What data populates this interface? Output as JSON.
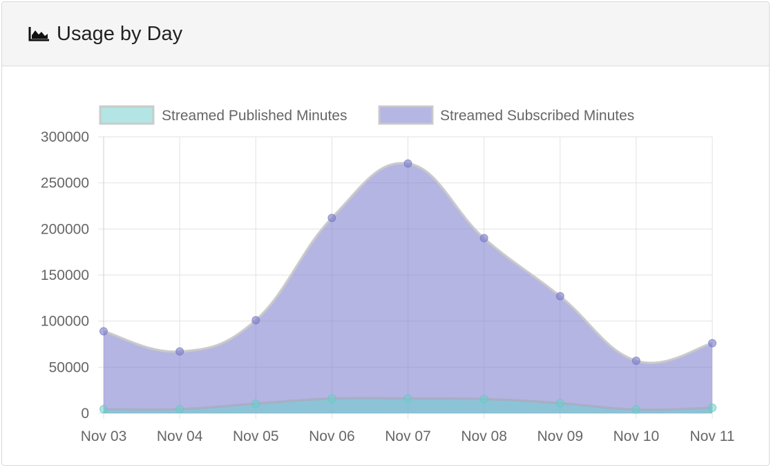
{
  "panel": {
    "title": "Usage by Day",
    "icon": "area-chart-icon"
  },
  "chart_data": {
    "type": "area",
    "categories": [
      "Nov 03",
      "Nov 04",
      "Nov 05",
      "Nov 06",
      "Nov 07",
      "Nov 08",
      "Nov 09",
      "Nov 10",
      "Nov 11"
    ],
    "series": [
      {
        "name": "Streamed Published Minutes",
        "values": [
          4500,
          4500,
          10500,
          16000,
          16000,
          15500,
          11000,
          4000,
          6000
        ],
        "color": "#7fd3d0"
      },
      {
        "name": "Streamed Subscribed Minutes",
        "values": [
          89000,
          67000,
          101000,
          212000,
          271000,
          190000,
          127000,
          57000,
          76000
        ],
        "color": "#8e8fd4"
      }
    ],
    "yticks": [
      "300000",
      "250000",
      "200000",
      "150000",
      "100000",
      "50000",
      "0"
    ],
    "ylim": [
      0,
      300000
    ],
    "legend": "top",
    "grid": true
  }
}
